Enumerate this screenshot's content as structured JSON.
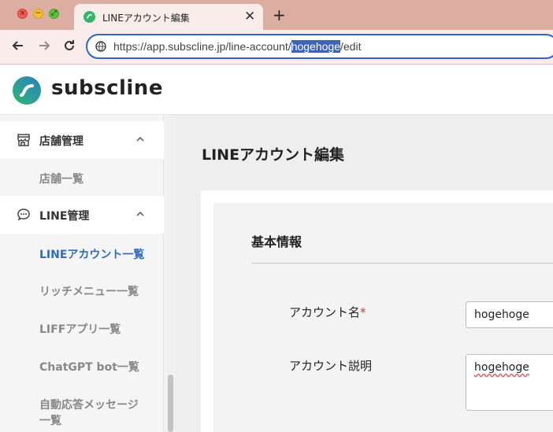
{
  "browser": {
    "tab_title": "LINEアカウント編集",
    "new_tab_label": "+",
    "close_tab_label": "✕",
    "url_prefix": "https://app.subscline.jp/line-account/",
    "url_selected": "hogehoge",
    "url_suffix": "/edit"
  },
  "app": {
    "logo_text": "subscline"
  },
  "sidebar": {
    "sections": [
      {
        "label": "店舗管理",
        "icon": "store-icon",
        "expanded": true,
        "items": [
          {
            "label": "店舗一覧",
            "active": false
          }
        ]
      },
      {
        "label": "LINE管理",
        "icon": "chat-bubble-icon",
        "expanded": true,
        "items": [
          {
            "label": "LINEアカウント一覧",
            "active": true
          },
          {
            "label": "リッチメニュー一覧",
            "active": false
          },
          {
            "label": "LIFFアプリ一覧",
            "active": false
          },
          {
            "label": "ChatGPT bot一覧",
            "active": false
          },
          {
            "label": "自動応答メッセージ",
            "active": false
          },
          {
            "label": "一覧",
            "active": false
          }
        ]
      }
    ]
  },
  "main": {
    "page_title": "LINEアカウント編集",
    "section_title": "基本情報",
    "fields": {
      "account_name": {
        "label": "アカウント名",
        "required_mark": "*",
        "value": "hogehoge"
      },
      "account_description": {
        "label": "アカウント説明",
        "value": "hogehoge"
      }
    }
  },
  "colors": {
    "accent": "#2d6cc2",
    "tabbar": "#dcaea2",
    "logo_green": "#2fb86a",
    "logo_blue": "#2a7fc9"
  }
}
